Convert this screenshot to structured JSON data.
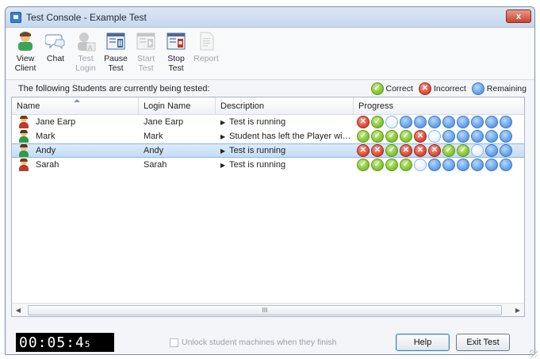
{
  "window": {
    "title": "Test Console - Example Test",
    "close_label": "x"
  },
  "toolbar": [
    {
      "l1": "View",
      "l2": "Client",
      "icon": "view-client-icon",
      "enabled": true
    },
    {
      "l1": "Chat",
      "l2": "",
      "icon": "chat-icon",
      "enabled": true
    },
    {
      "l1": "Test",
      "l2": "Login",
      "icon": "test-login-icon",
      "enabled": false
    },
    {
      "l1": "Pause",
      "l2": "Test",
      "icon": "pause-test-icon",
      "enabled": true
    },
    {
      "l1": "Start",
      "l2": "Test",
      "icon": "start-test-icon",
      "enabled": false
    },
    {
      "l1": "Stop",
      "l2": "Test",
      "icon": "stop-test-icon",
      "enabled": true
    },
    {
      "l1": "Report",
      "l2": "",
      "icon": "report-icon",
      "enabled": false
    }
  ],
  "status": {
    "message": "The following Students are currently being tested:",
    "legend_correct": "Correct",
    "legend_incorrect": "Incorrect",
    "legend_remaining": "Remaining"
  },
  "columns": {
    "name": "Name",
    "login": "Login Name",
    "description": "Description",
    "progress": "Progress"
  },
  "students": [
    {
      "name": "Jane Earp",
      "login": "Jane Earp",
      "description": "Test is running",
      "avatar": "female",
      "selected": false,
      "progress": [
        "incorrect",
        "correct",
        "current",
        "remaining",
        "remaining",
        "remaining",
        "remaining",
        "remaining",
        "remaining",
        "remaining",
        "remaining"
      ]
    },
    {
      "name": "Mark",
      "login": "Mark",
      "description": "Student has left the Player wind...",
      "avatar": "male",
      "selected": false,
      "progress": [
        "correct",
        "correct",
        "correct",
        "correct",
        "incorrect",
        "current",
        "remaining",
        "remaining",
        "remaining",
        "remaining",
        "remaining"
      ]
    },
    {
      "name": "Andy",
      "login": "Andy",
      "description": "Test is running",
      "avatar": "male",
      "selected": true,
      "progress": [
        "incorrect",
        "incorrect",
        "correct",
        "incorrect",
        "incorrect",
        "incorrect",
        "correct",
        "correct",
        "current",
        "remaining",
        "remaining"
      ]
    },
    {
      "name": "Sarah",
      "login": "Sarah",
      "description": "Test is running",
      "avatar": "female",
      "selected": false,
      "progress": [
        "correct",
        "correct",
        "correct",
        "correct",
        "current",
        "remaining",
        "remaining",
        "remaining",
        "remaining",
        "remaining",
        "remaining"
      ]
    }
  ],
  "scroll": {
    "thumb_grip": "III",
    "left_arrow": "◀",
    "right_arrow": "▶"
  },
  "footer": {
    "timer": "00:05:4",
    "timer_tail": "5",
    "unlock_label": "Unlock student machines when they finish",
    "unlock_checked": false,
    "help_label": "Help",
    "exit_label": "Exit Test"
  },
  "colors": {
    "correct": "#7cbf2a",
    "incorrect": "#d8432f",
    "remaining": "#5b9be6",
    "selected_row": "#c4dcf6"
  }
}
